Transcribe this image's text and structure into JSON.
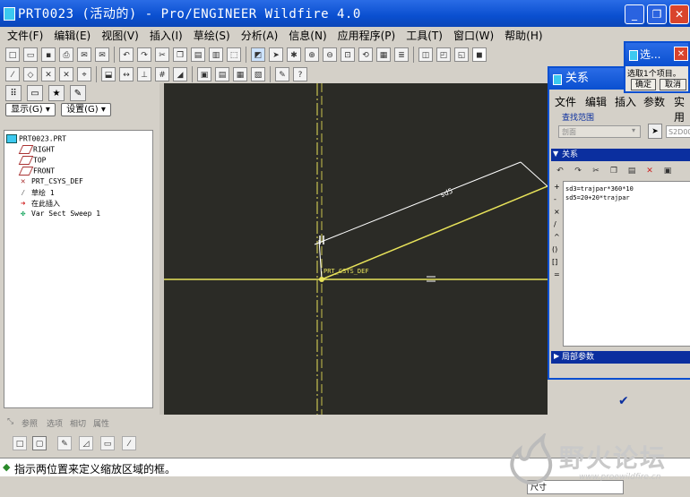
{
  "window": {
    "title": "PRT0023 (活动的) - Pro/ENGINEER Wildfire 4.0",
    "min": "_",
    "max": "❐",
    "close": "✕"
  },
  "menubar": [
    "文件(F)",
    "编辑(E)",
    "视图(V)",
    "插入(I)",
    "草绘(S)",
    "分析(A)",
    "信息(N)",
    "应用程序(P)",
    "工具(T)",
    "窗口(W)",
    "帮助(H)"
  ],
  "left_panel": {
    "show_button": "显示(G) ▾",
    "settings_button": "设置(G) ▾",
    "tree": [
      {
        "label": "PRT0023.PRT",
        "level": 0,
        "icon": "part-icon"
      },
      {
        "label": "RIGHT",
        "level": 1,
        "icon": "datum-plane-icon"
      },
      {
        "label": "TOP",
        "level": 1,
        "icon": "datum-plane-icon"
      },
      {
        "label": "FRONT",
        "level": 1,
        "icon": "datum-plane-icon"
      },
      {
        "label": "PRT_CSYS_DEF",
        "level": 1,
        "icon": "csys-icon"
      },
      {
        "label": "草绘 1",
        "level": 1,
        "icon": "sketch-icon"
      },
      {
        "label": "在此插入",
        "level": 1,
        "icon": "insert-arrow-icon"
      },
      {
        "label": "Var Sect Sweep 1",
        "level": 1,
        "icon": "sweep-icon"
      }
    ]
  },
  "dashboard_tabs": [
    "参照",
    "选项",
    "相切",
    "属性"
  ],
  "status_message": "指示两位置来定义缩放区域的框。",
  "filter": "尺寸",
  "relations_dialog": {
    "title": "关系",
    "menu": [
      "文件",
      "编辑",
      "插入",
      "参数",
      "实用"
    ],
    "lookin_label": "查找范围",
    "lookin_value": "剖面",
    "item_value": "S2D00",
    "section_title": "关系",
    "relations": [
      "sd3=trajpar*360*10",
      "sd5=20+20*trajpar"
    ],
    "symbols": [
      "+",
      "-",
      "×",
      "/",
      "^",
      "()",
      "[]",
      "="
    ],
    "local_params": "局部参数"
  },
  "select_dialog": {
    "title": "选...",
    "message": "选取1个项目。",
    "ok": "确定",
    "cancel": "取消"
  },
  "canvas": {
    "dim_label": "sd5",
    "csys_label": "PRT_CSYS_DEF",
    "bg": "#2b2b26",
    "line_color": "#e8e35a",
    "dim_color": "#ffffff"
  },
  "watermark": {
    "text": "野火论坛",
    "url": "www.proewildfire.cn"
  }
}
